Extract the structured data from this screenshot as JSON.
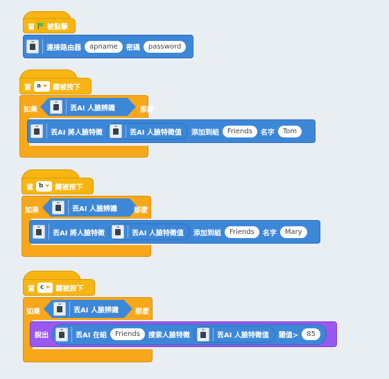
{
  "script1": {
    "hat_when": "當",
    "hat_clicked": "被點擊",
    "connect_label": "連接路由器",
    "apname": "apname",
    "password_label": "密碼",
    "password": "password"
  },
  "script2": {
    "hat_when": "當",
    "key": "a",
    "key_pressed": "鍵被按下",
    "if_label": "如果",
    "recognize": "丟AI 人臉辨識",
    "then_label": "那麼",
    "add_feature": "丟AI 將人臉特徵",
    "feature_value": "丟AI 人臉特徵值",
    "add_to_group": "添加到組",
    "group": "Friends",
    "name_label": "名字",
    "name": "Tom"
  },
  "script3": {
    "hat_when": "當",
    "key": "b",
    "key_pressed": "鍵被按下",
    "if_label": "如果",
    "recognize": "丟AI 人臉辨識",
    "then_label": "那麼",
    "add_feature": "丟AI 將人臉特徵",
    "feature_value": "丟AI 人臉特徵值",
    "add_to_group": "添加到組",
    "group": "Friends",
    "name_label": "名字",
    "name": "Mary"
  },
  "script4": {
    "hat_when": "當",
    "key": "c",
    "key_pressed": "鍵被按下",
    "if_label": "如果",
    "recognize": "丟AI 人臉辨識",
    "then_label": "那麼",
    "say_label": "說出",
    "in_group": "丟AI 在組",
    "group": "Friends",
    "search_feature": "搜索人臉特徵",
    "feature_value": "丟AI 人臉特徵值",
    "threshold_label": "閾值>",
    "threshold": "85"
  },
  "colors": {
    "event": "#f7b512",
    "control": "#f7a81a",
    "ai_block": "#3d87d8",
    "looks": "#9a58f0",
    "background": "#e9eef2"
  }
}
